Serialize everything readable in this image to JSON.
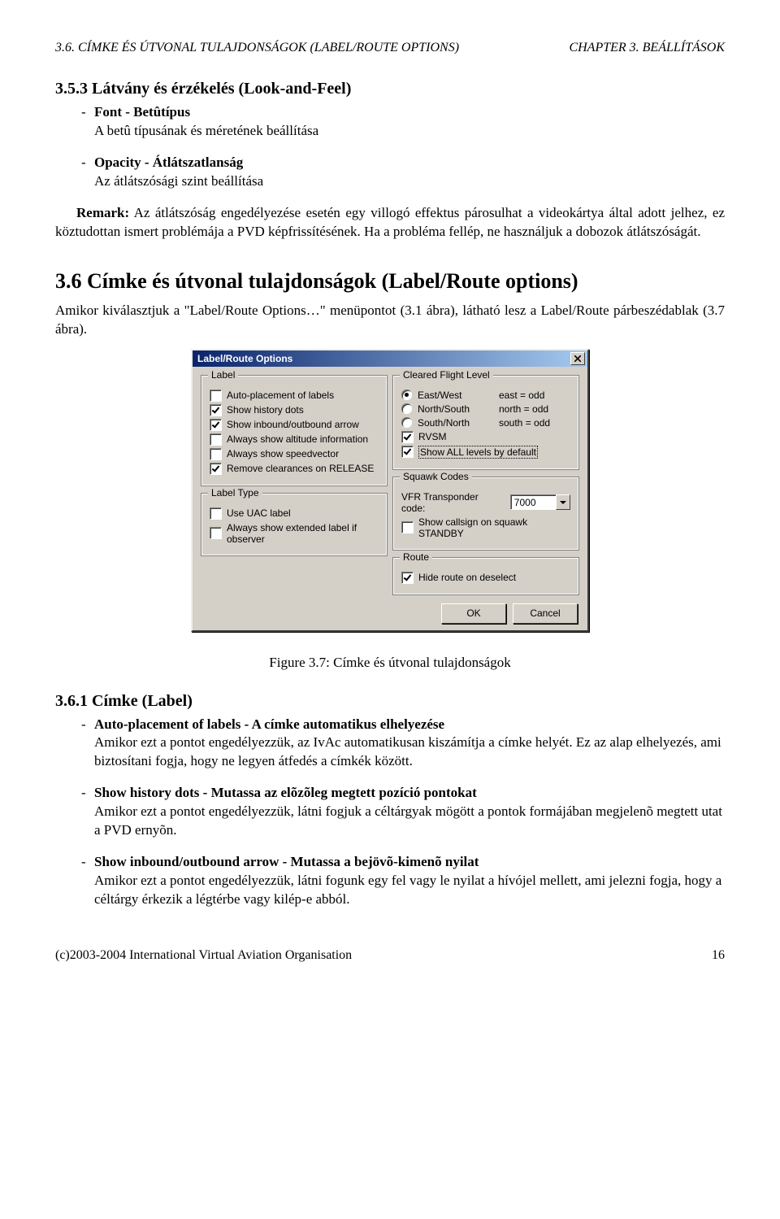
{
  "header": {
    "left": "3.6. CÍMKE ÉS ÚTVONAL TULAJDONSÁGOK (LABEL/ROUTE OPTIONS)",
    "right": "CHAPTER 3. BEÁLLÍTÁSOK"
  },
  "s353": {
    "title": "3.5.3   Látvány és érzékelés (Look-and-Feel)",
    "items": [
      {
        "head": "Font - Betûtípus",
        "body": "A betû típusának és méretének beállítása"
      },
      {
        "head": "Opacity - Átlátszatlanság",
        "body": "Az átlátszósági szint beállítása"
      }
    ],
    "remark_label": "Remark:",
    "remark": "Az átlátszóság engedélyezése esetén egy villogó effektus párosulhat a videokártya által adott jelhez, ez köztudottan ismert problémája a PVD képfrissítésének. Ha a probléma fellép, ne használjuk a dobozok átlátszóságát."
  },
  "s36": {
    "title": "3.6   Címke és útvonal tulajdonságok (Label/Route options)",
    "intro": "Amikor kiválasztjuk a \"Label/Route Options…\" menüpontot (3.1 ábra), látható lesz a Label/Route párbeszédablak (3.7 ábra)."
  },
  "dialog": {
    "title": "Label/Route Options",
    "groups": {
      "label": {
        "title": "Label",
        "items": [
          {
            "checked": false,
            "text": "Auto-placement of labels"
          },
          {
            "checked": true,
            "text": "Show history dots"
          },
          {
            "checked": true,
            "text": "Show inbound/outbound arrow"
          },
          {
            "checked": false,
            "text": "Always show altitude information"
          },
          {
            "checked": false,
            "text": "Always show speedvector"
          },
          {
            "checked": true,
            "text": "Remove clearances on RELEASE"
          }
        ]
      },
      "label_type": {
        "title": "Label Type",
        "items": [
          {
            "checked": false,
            "text": "Use UAC label"
          },
          {
            "checked": false,
            "text": "Always show extended label if observer"
          }
        ]
      },
      "cfl": {
        "title": "Cleared Flight Level",
        "radios": [
          {
            "sel": true,
            "opt": "East/West",
            "hint": "east = odd"
          },
          {
            "sel": false,
            "opt": "North/South",
            "hint": "north = odd"
          },
          {
            "sel": false,
            "opt": "South/North",
            "hint": "south = odd"
          }
        ],
        "checks": [
          {
            "checked": true,
            "text": "RVSM",
            "focus": false
          },
          {
            "checked": true,
            "text": "Show ALL levels by default",
            "focus": true
          }
        ]
      },
      "squawk": {
        "title": "Squawk Codes",
        "input_label": "VFR Transponder code:",
        "input_value": "7000",
        "check": {
          "checked": false,
          "text": "Show callsign on squawk STANDBY"
        }
      },
      "route": {
        "title": "Route",
        "check": {
          "checked": true,
          "text": "Hide route on deselect"
        }
      }
    },
    "ok": "OK",
    "cancel": "Cancel"
  },
  "figcaption": "Figure 3.7: Címke és útvonal tulajdonságok",
  "s361": {
    "title": "3.6.1   Címke (Label)",
    "items": [
      {
        "head": "Auto-placement of labels - A címke automatikus elhelyezése",
        "body": "Amikor ezt a pontot engedélyezzük, az IvAc automatikusan kiszámítja a címke helyét. Ez az alap elhelyezés, ami biztosítani fogja, hogy ne legyen átfedés a címkék között."
      },
      {
        "head": "Show history dots - Mutassa az elõzõleg megtett pozíció pontokat",
        "body": "Amikor ezt a pontot engedélyezzük, látni fogjuk a céltárgyak mögött a pontok formájában megjelenõ megtett utat a PVD ernyõn."
      },
      {
        "head": "Show inbound/outbound arrow - Mutassa a bejövõ-kimenõ nyilat",
        "body": "Amikor ezt a pontot engedélyezzük, látni fogunk egy fel vagy le nyilat a hívójel mellett, ami jelezni fogja, hogy a céltárgy érkezik a légtérbe vagy kilép-e abból."
      }
    ]
  },
  "footer": {
    "left": "(c)2003-2004 International Virtual Aviation Organisation",
    "right": "16"
  }
}
